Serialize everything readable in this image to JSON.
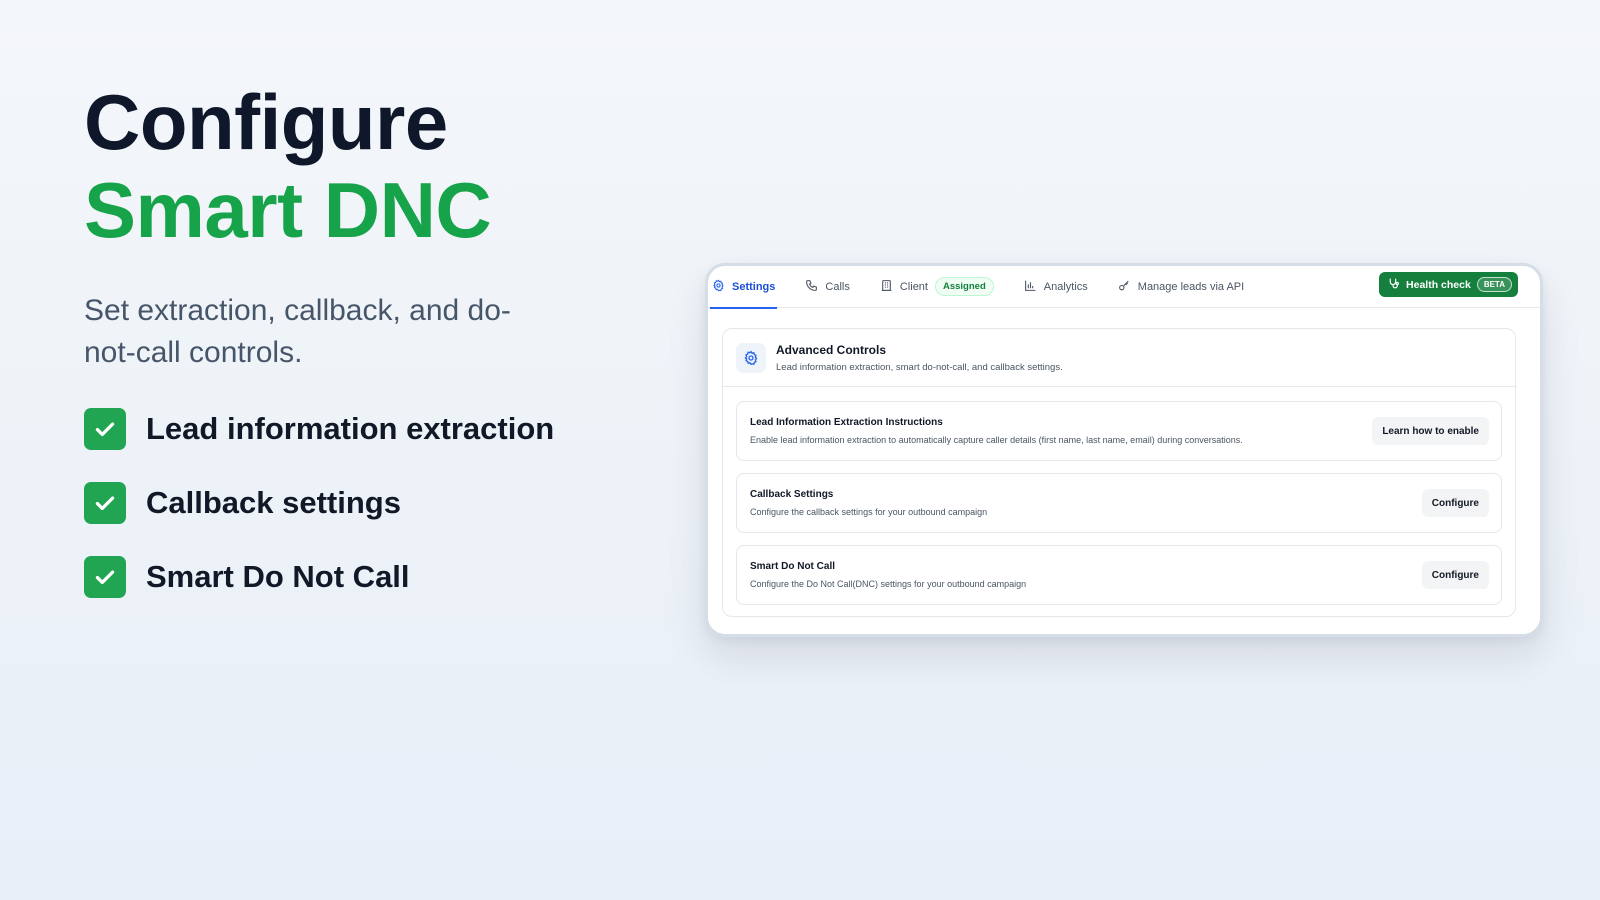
{
  "hero": {
    "title_line1": "Configure",
    "title_line2": "Smart DNC",
    "subtitle": "Set extraction, callback, and do-not-call controls.",
    "features": [
      {
        "label": "Lead information extraction",
        "icon": "check-icon"
      },
      {
        "label": "Callback settings",
        "icon": "check-icon"
      },
      {
        "label": "Smart Do Not Call",
        "icon": "check-icon"
      }
    ]
  },
  "tabs": [
    {
      "label": "Settings",
      "icon": "gear-icon",
      "active": true
    },
    {
      "label": "Calls",
      "icon": "phone-icon"
    },
    {
      "label": "Client",
      "icon": "building-icon",
      "badge": "Assigned"
    },
    {
      "label": "Analytics",
      "icon": "bar-chart-icon"
    },
    {
      "label": "Manage leads via API",
      "icon": "key-icon"
    }
  ],
  "health_check": {
    "label": "Health check",
    "badge": "BETA",
    "icon": "stethoscope-icon"
  },
  "panel": {
    "title": "Advanced Controls",
    "description": "Lead information extraction, smart do-not-call, and callback settings.",
    "icon": "gear-icon",
    "rows": [
      {
        "title": "Lead Information Extraction Instructions",
        "description": "Enable lead information extraction to automatically capture caller details (first name, last name, email) during conversations.",
        "button": "Learn how to enable"
      },
      {
        "title": "Callback Settings",
        "description": "Configure the callback settings for your outbound campaign",
        "button": "Configure"
      },
      {
        "title": "Smart Do Not Call",
        "description": "Configure the Do Not Call(DNC) settings for your outbound campaign",
        "button": "Configure"
      }
    ]
  },
  "colors": {
    "accent_green": "#16a34a",
    "accent_blue": "#2563eb",
    "title_dark": "#0f172a"
  }
}
